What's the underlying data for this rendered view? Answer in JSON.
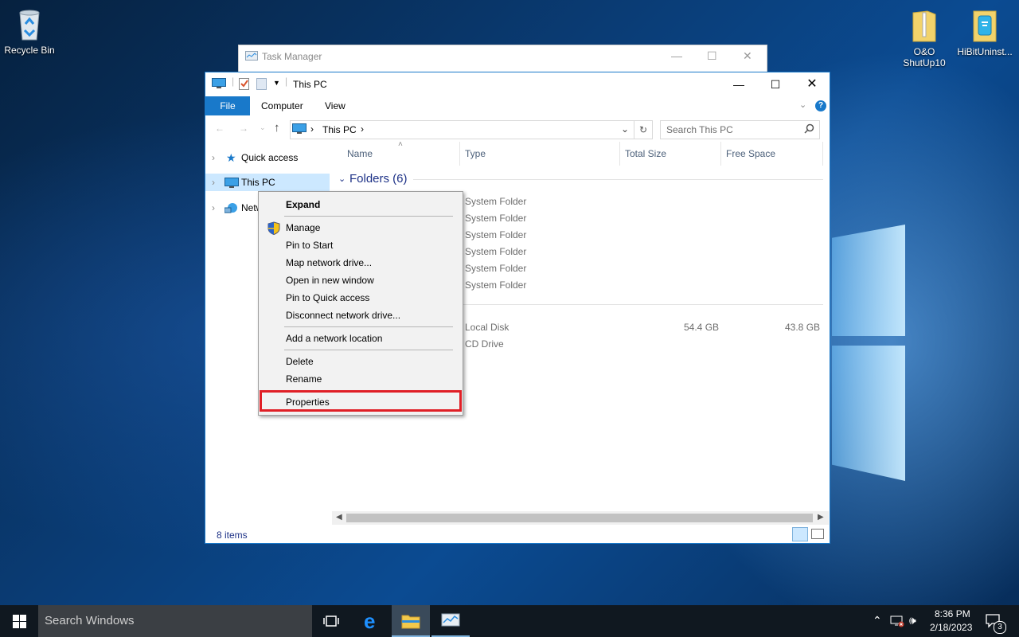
{
  "desktop": {
    "icons": [
      {
        "label": "Recycle Bin"
      },
      {
        "label": "O&O ShutUp10"
      },
      {
        "label": "HiBitUninst..."
      }
    ]
  },
  "task_manager": {
    "title": "Task Manager",
    "minimize": "—",
    "maximize": "☐",
    "close": "✕"
  },
  "explorer": {
    "title": "This PC",
    "controls": {
      "minimize": "—",
      "maximize": "☐",
      "close": "✕"
    },
    "ribbon_tabs": [
      "File",
      "Computer",
      "View"
    ],
    "address": {
      "crumb": "This PC",
      "chev": "›"
    },
    "search_placeholder": "Search This PC",
    "nav": [
      {
        "label": "Quick access"
      },
      {
        "label": "This PC"
      },
      {
        "label": "Network"
      }
    ],
    "columns": [
      "Name",
      "Type",
      "Total Size",
      "Free Space"
    ],
    "group_folders": "Folders (6)",
    "folder_types": [
      "System Folder",
      "System Folder",
      "System Folder",
      "System Folder",
      "System Folder",
      "System Folder"
    ],
    "drives": [
      {
        "type": "Local Disk",
        "total": "54.4 GB",
        "free": "43.8 GB"
      },
      {
        "type": "CD Drive",
        "total": "",
        "free": ""
      }
    ],
    "status": "8 items"
  },
  "context_menu": {
    "expand": "Expand",
    "manage": "Manage",
    "pin_start": "Pin to Start",
    "map_drive": "Map network drive...",
    "open_new": "Open in new window",
    "pin_quick": "Pin to Quick access",
    "disconnect": "Disconnect network drive...",
    "add_location": "Add a network location",
    "delete": "Delete",
    "rename": "Rename",
    "properties": "Properties"
  },
  "taskbar": {
    "search_placeholder": "Search Windows",
    "time": "8:36 PM",
    "date": "2/18/2023",
    "notification_count": "3"
  },
  "colors": {
    "accent": "#1979ca",
    "highlight": "#e01f26",
    "selection": "#cce8ff"
  }
}
